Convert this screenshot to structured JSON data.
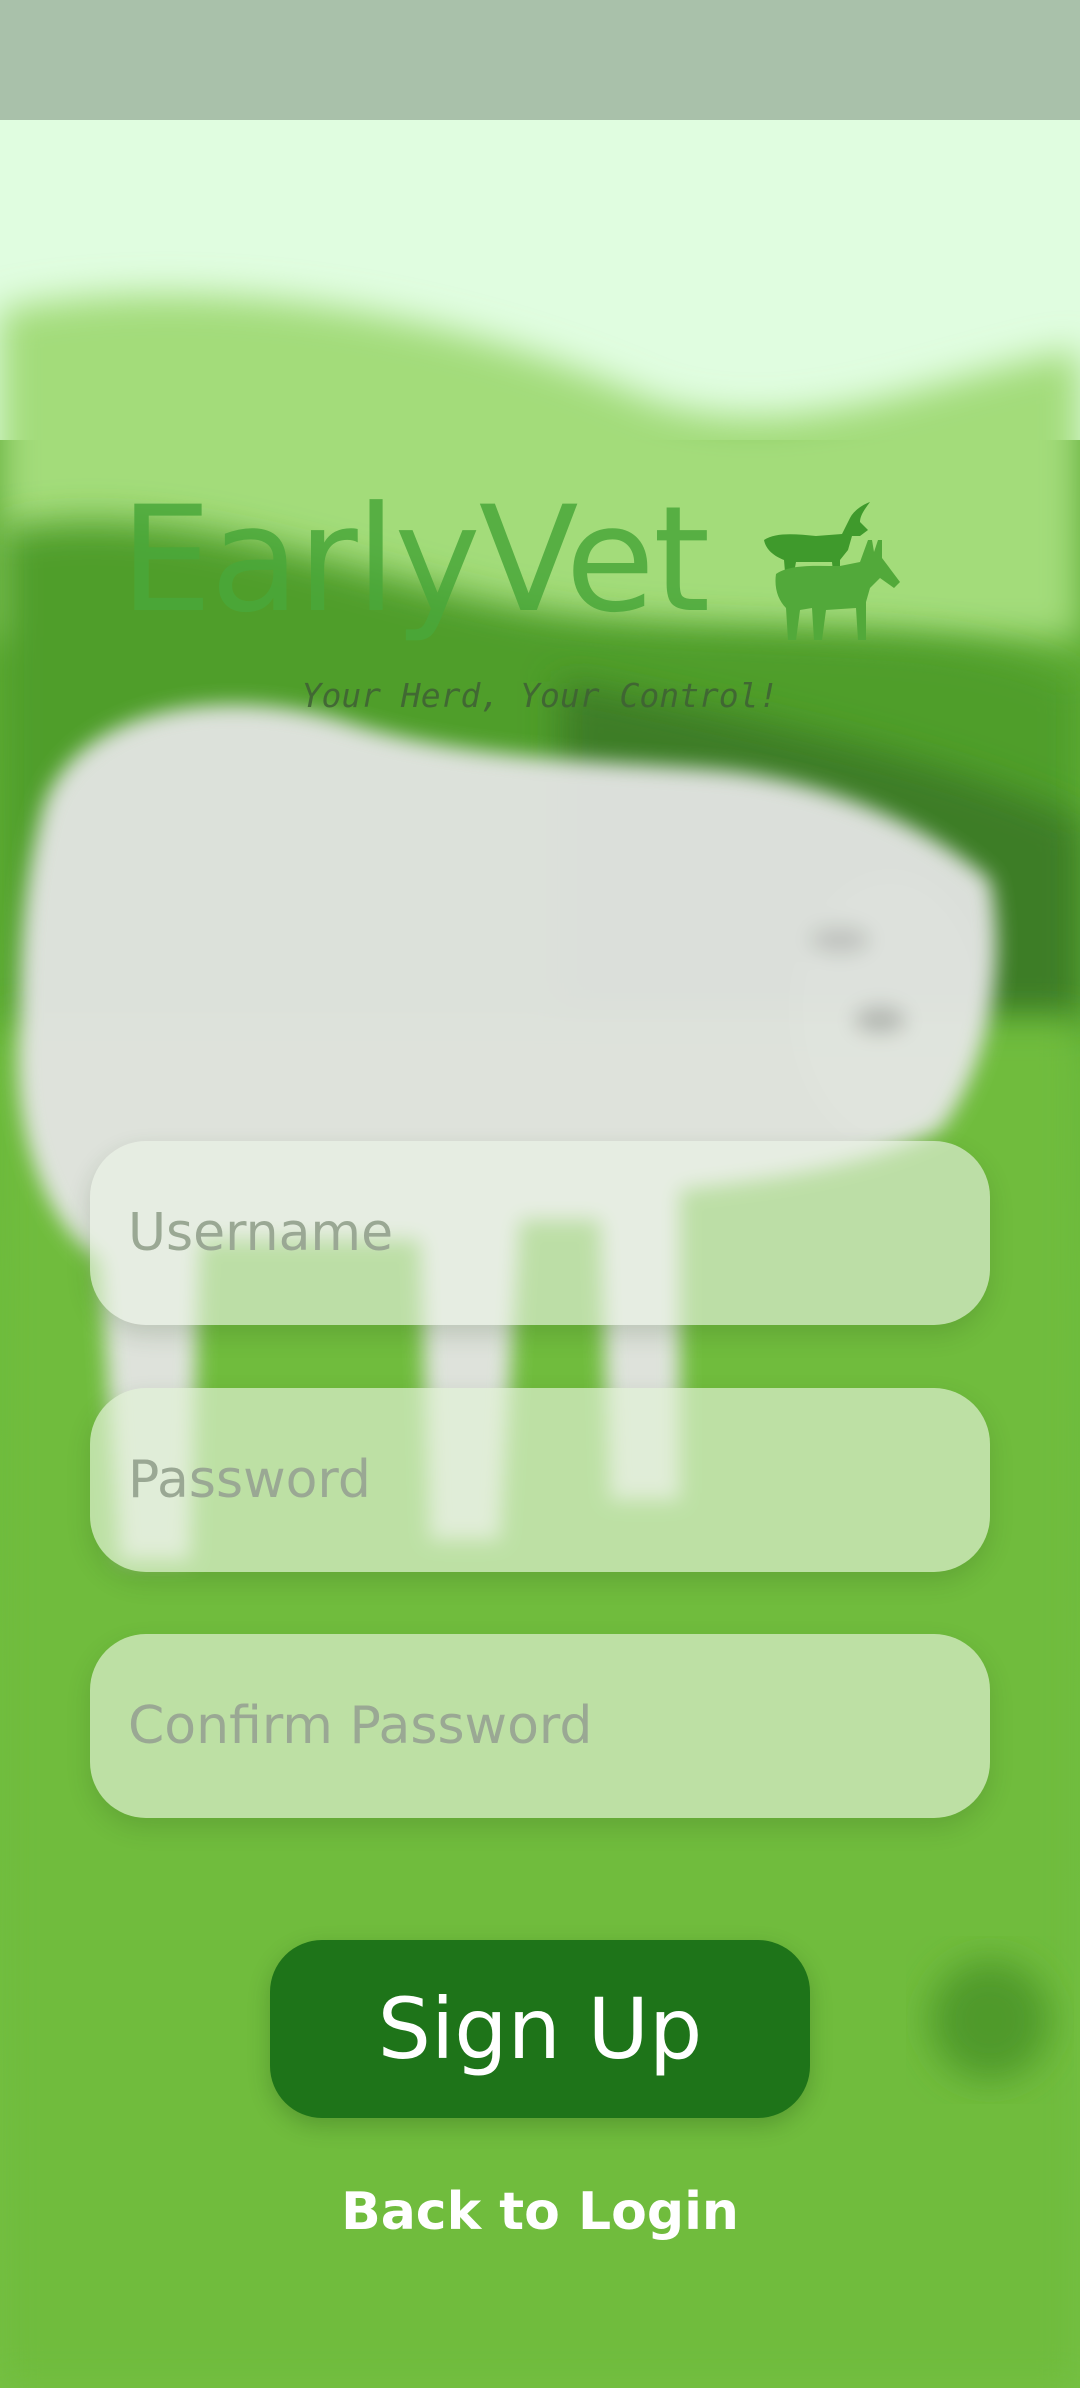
{
  "app": {
    "logo_text": "EarlyVet",
    "logo_icon": "goat-and-donkey-icon",
    "tagline": "Your Herd, Your Control!"
  },
  "form": {
    "username_placeholder": "Username",
    "password_placeholder": "Password",
    "confirm_password_placeholder": "Confirm Password",
    "signup_label": "Sign Up",
    "back_to_login_label": "Back to Login"
  },
  "colors": {
    "status_bar": "#a9c1aa",
    "primary_button": "#1e7419",
    "background_green": "#74c03e",
    "sky": "#e0fde0"
  }
}
